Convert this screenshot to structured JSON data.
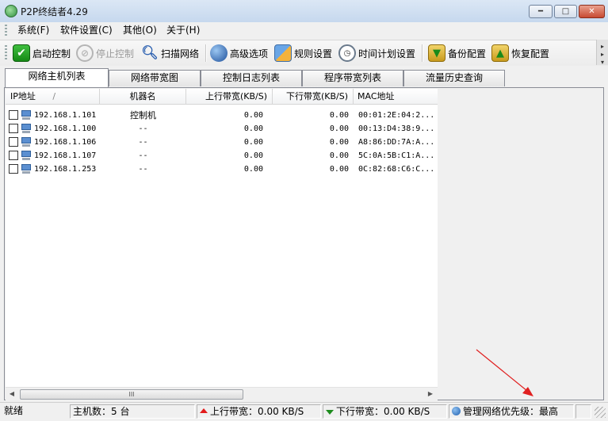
{
  "window": {
    "title": "P2P终结者4.29",
    "icons": {
      "app": "app-logo-icon",
      "minimize": "minimize-icon",
      "maximize": "maximize-icon",
      "close": "close-icon"
    }
  },
  "menu": {
    "items": [
      "系统(F)",
      "软件设置(C)",
      "其他(O)",
      "关于(H)"
    ]
  },
  "toolbar": {
    "start_control": "启动控制",
    "stop_control": "停止控制",
    "scan_network": "扫描网络",
    "advanced_options": "高级选项",
    "rule_settings": "规则设置",
    "schedule_settings": "时间计划设置",
    "backup_config": "备份配置",
    "restore_config": "恢复配置",
    "icons": [
      "checkmark-icon",
      "stop-icon",
      "magnifier-icon",
      "network-globe-icon",
      "rules-icon",
      "clock-icon",
      "backup-icon",
      "restore-icon"
    ]
  },
  "tabs": [
    "网络主机列表",
    "网络带宽图",
    "控制日志列表",
    "程序带宽列表",
    "流量历史查询"
  ],
  "table": {
    "columns": [
      "IP地址",
      "机器名",
      "上行带宽(KB/S)",
      "下行带宽(KB/S)",
      "MAC地址"
    ],
    "sort_indicator": "/",
    "rows": [
      {
        "ip": "192.168.1.101",
        "name": "控制机",
        "up": "0.00",
        "down": "0.00",
        "mac": "00:01:2E:04:2..."
      },
      {
        "ip": "192.168.1.100",
        "name": "--",
        "up": "0.00",
        "down": "0.00",
        "mac": "00:13:D4:38:9..."
      },
      {
        "ip": "192.168.1.106",
        "name": "--",
        "up": "0.00",
        "down": "0.00",
        "mac": "A8:86:DD:7A:A..."
      },
      {
        "ip": "192.168.1.107",
        "name": "--",
        "up": "0.00",
        "down": "0.00",
        "mac": "5C:0A:5B:C1:A..."
      },
      {
        "ip": "192.168.1.253",
        "name": "--",
        "up": "0.00",
        "down": "0.00",
        "mac": "0C:82:68:C6:C..."
      }
    ]
  },
  "scrollbar": {
    "left_arrow": "◀",
    "right_arrow": "▶",
    "thumb_grip": "III"
  },
  "status": {
    "ready": "就绪",
    "host_count": "主机数：5 台",
    "upload": "上行带宽：0.00 KB/S",
    "download": "下行带宽：0.00 KB/S",
    "priority": "管理网络优先级：最高"
  },
  "colors": {
    "annotation_arrow": "#e02020",
    "up_arrow": "#e21b1b",
    "down_arrow": "#1e8c1e"
  }
}
